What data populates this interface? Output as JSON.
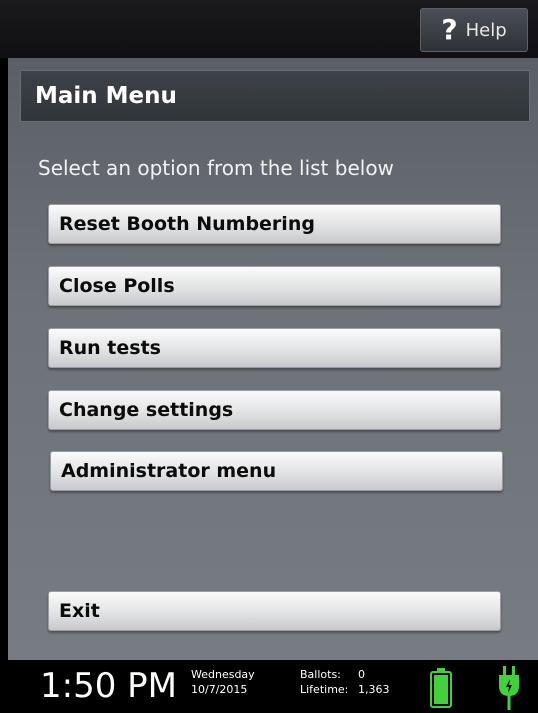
{
  "header": {
    "help_label": "Help",
    "help_glyph": "?"
  },
  "main": {
    "title": "Main Menu",
    "instruction": "Select an option from the list below",
    "buttons": [
      {
        "label": "Reset Booth Numbering"
      },
      {
        "label": "Close Polls"
      },
      {
        "label": "Run tests"
      },
      {
        "label": "Change settings"
      },
      {
        "label": "Administrator menu"
      }
    ],
    "exit_label": "Exit"
  },
  "status": {
    "time": "1:50 PM",
    "day": "Wednesday",
    "date": "10/7/2015",
    "ballots_label": "Ballots:",
    "ballots_value": "0",
    "lifetime_label": "Lifetime:",
    "lifetime_value": "1,363",
    "battery_icon": "battery-full-icon",
    "power_icon": "ac-power-plug-icon",
    "accent_green": "#3fd23a"
  }
}
